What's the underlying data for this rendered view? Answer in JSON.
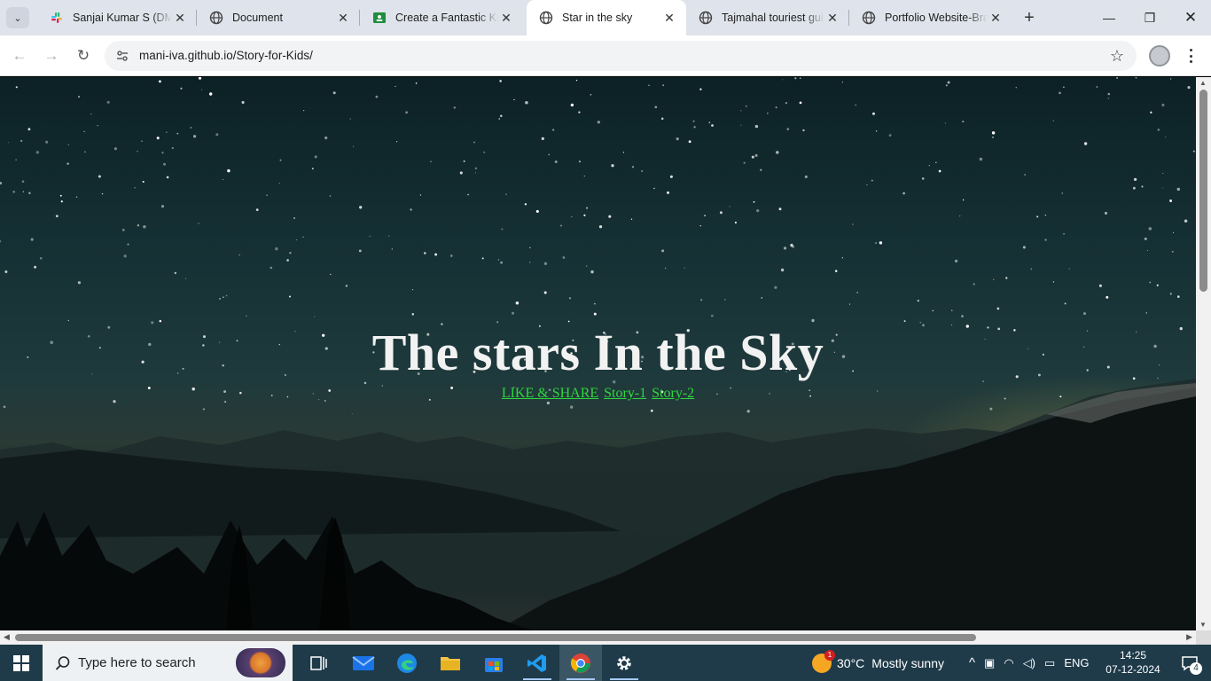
{
  "browser": {
    "tabs": [
      {
        "title": "Sanjai Kumar S (DM) -",
        "icon": "slack-icon",
        "active": false
      },
      {
        "title": "Document",
        "icon": "globe-icon",
        "active": false
      },
      {
        "title": "Create a Fantastic Kid",
        "icon": "classroom-icon",
        "active": false
      },
      {
        "title": "Star in the sky",
        "icon": "globe-icon",
        "active": true
      },
      {
        "title": "Tajmahal touriest gui",
        "icon": "globe-icon",
        "active": false
      },
      {
        "title": "Portfolio Website-Bra",
        "icon": "globe-icon",
        "active": false
      }
    ],
    "close_glyph": "✕",
    "new_tab_glyph": "+",
    "tab_search_glyph": "⌄",
    "minimize_glyph": "—",
    "restore_glyph": "❐",
    "close_window_glyph": "✕",
    "back_glyph": "←",
    "forward_glyph": "→",
    "reload_glyph": "↻",
    "star_glyph": "☆",
    "url": "mani-iva.github.io/Story-for-Kids/"
  },
  "page": {
    "title": "The stars In the Sky",
    "links": [
      "LIKE & SHARE",
      "Story-1",
      "Story-2"
    ],
    "link_color": "#2fd63f",
    "title_color": "#f2f2f2"
  },
  "taskbar": {
    "search_placeholder": "Type here to search",
    "weather_temp": "30°C",
    "weather_text": "Mostly sunny",
    "weather_badge": "1",
    "language": "ENG",
    "time": "14:25",
    "date": "07-12-2024",
    "notification_count": "4",
    "tray_up_glyph": "^",
    "accent_color": "#1f3b4a"
  }
}
